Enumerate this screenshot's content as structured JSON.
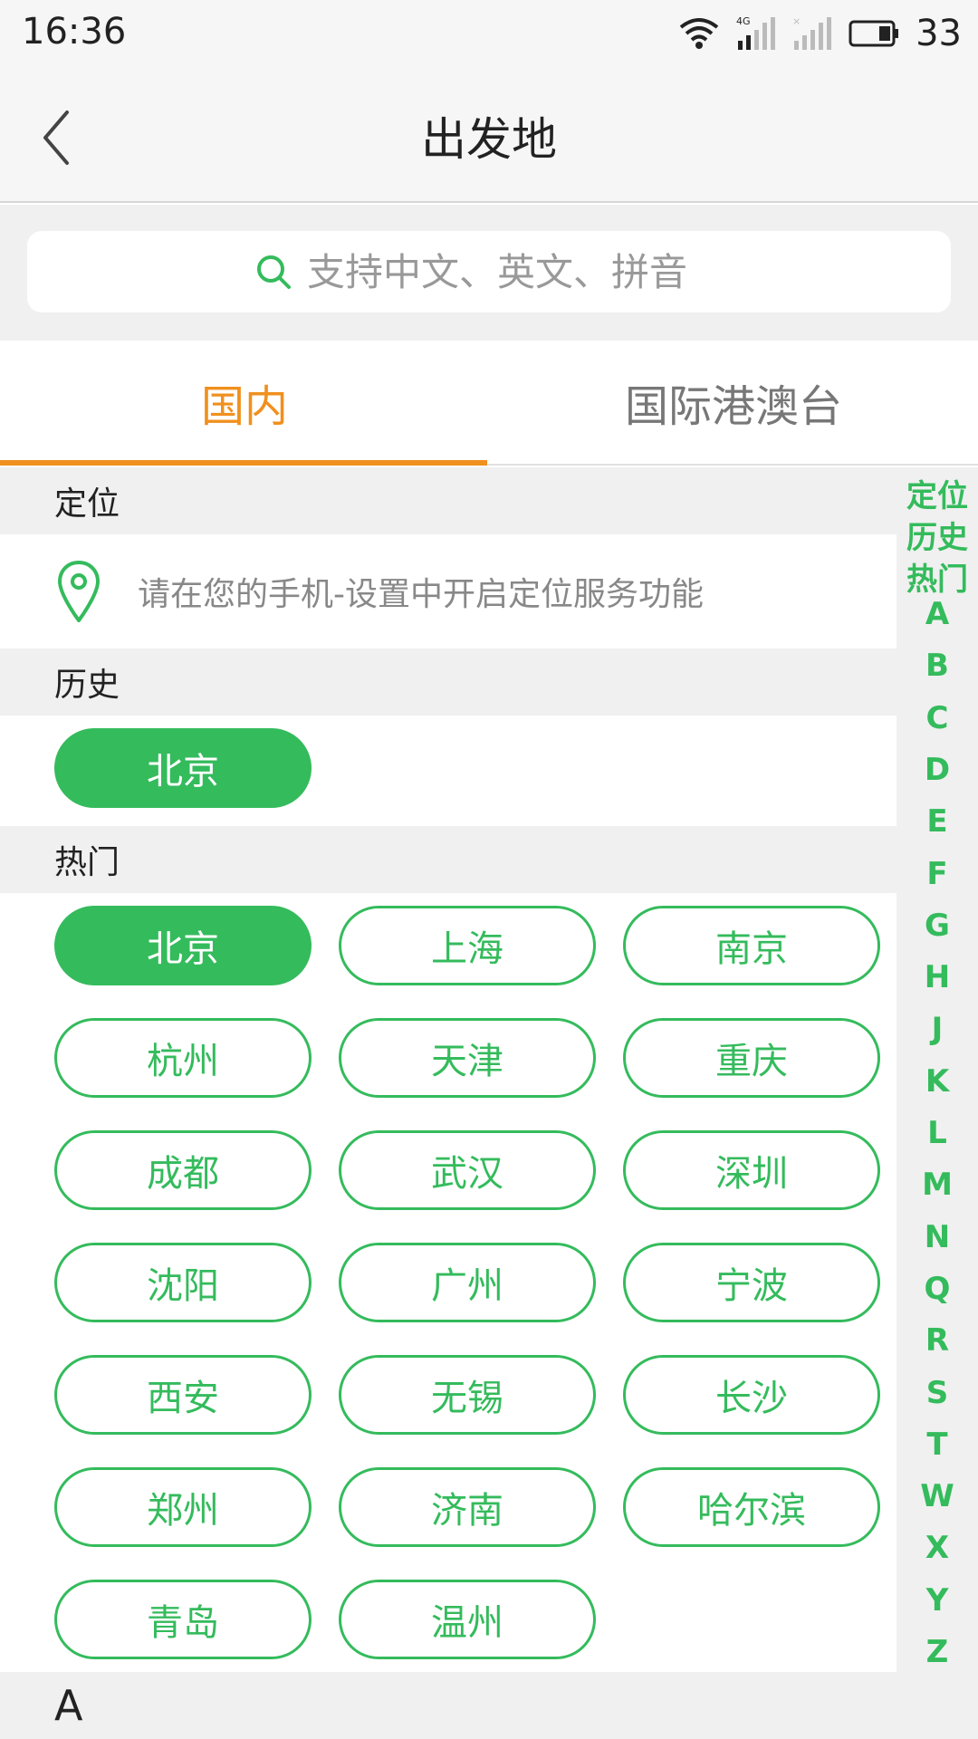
{
  "status_bar": {
    "time": "16:36",
    "battery": "33"
  },
  "header": {
    "title": "出发地"
  },
  "search": {
    "placeholder": "支持中文、英文、拼音"
  },
  "tabs": [
    {
      "label": "国内",
      "active": true
    },
    {
      "label": "国际港澳台",
      "active": false
    }
  ],
  "sections": {
    "locate": {
      "title": "定位",
      "message": "请在您的手机-设置中开启定位服务功能"
    },
    "history": {
      "title": "历史",
      "items": [
        "北京"
      ]
    },
    "hot": {
      "title": "热门",
      "cities": [
        "北京",
        "上海",
        "南京",
        "杭州",
        "天津",
        "重庆",
        "成都",
        "武汉",
        "深圳",
        "沈阳",
        "广州",
        "宁波",
        "西安",
        "无锡",
        "长沙",
        "郑州",
        "济南",
        "哈尔滨",
        "青岛",
        "温州"
      ],
      "selected": "北京"
    },
    "letter_a": {
      "title": "A"
    }
  },
  "index": [
    "定位",
    "历史",
    "热门",
    "A",
    "B",
    "C",
    "D",
    "E",
    "F",
    "G",
    "H",
    "J",
    "K",
    "L",
    "M",
    "N",
    "Q",
    "R",
    "S",
    "T",
    "W",
    "X",
    "Y",
    "Z"
  ],
  "colors": {
    "accent_green": "#34bb5c",
    "tab_orange": "#f0901e"
  }
}
